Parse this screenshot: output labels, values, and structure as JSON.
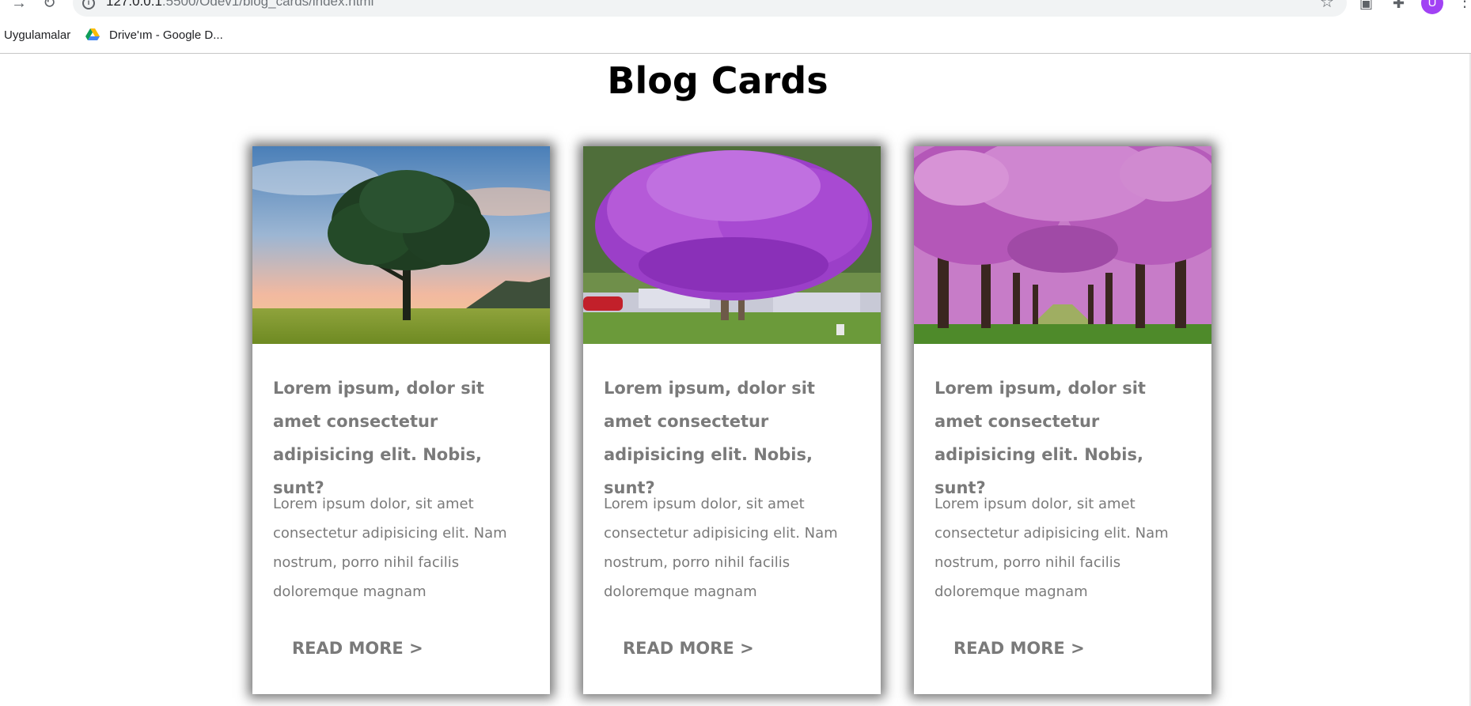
{
  "browser": {
    "url_host": "127.0.0.1",
    "url_path": ":5500/Odev1/blog_cards/index.html",
    "avatar_letter": "U",
    "bookmarks": [
      {
        "label": "Uygulamalar"
      },
      {
        "label": "Drive'ım - Google D..."
      }
    ]
  },
  "page": {
    "title": "Blog Cards"
  },
  "cards": [
    {
      "image": "tree-at-sunset",
      "title": "Lorem ipsum, dolor sit amet consectetur adipisicing elit. Nobis, sunt?",
      "text": "Lorem ipsum dolor, sit amet consectetur adipisicing elit. Nam nostrum, porro nihil facilis doloremque magnam",
      "link": "READ MORE >"
    },
    {
      "image": "purple-crape-myrtle-tree",
      "title": "Lorem ipsum, dolor sit amet consectetur adipisicing elit. Nobis, sunt?",
      "text": "Lorem ipsum dolor, sit amet consectetur adipisicing elit. Nam nostrum, porro nihil facilis doloremque magnam",
      "link": "READ MORE >"
    },
    {
      "image": "cherry-blossom-avenue",
      "title": "Lorem ipsum, dolor sit amet consectetur adipisicing elit. Nobis, sunt?",
      "text": "Lorem ipsum dolor, sit amet consectetur adipisicing elit. Nam nostrum, porro nihil facilis doloremque magnam",
      "link": "READ MORE >"
    }
  ],
  "colors": {
    "card_text": "#7a7a7a",
    "title": "#000000",
    "avatar": "#a142f4"
  }
}
